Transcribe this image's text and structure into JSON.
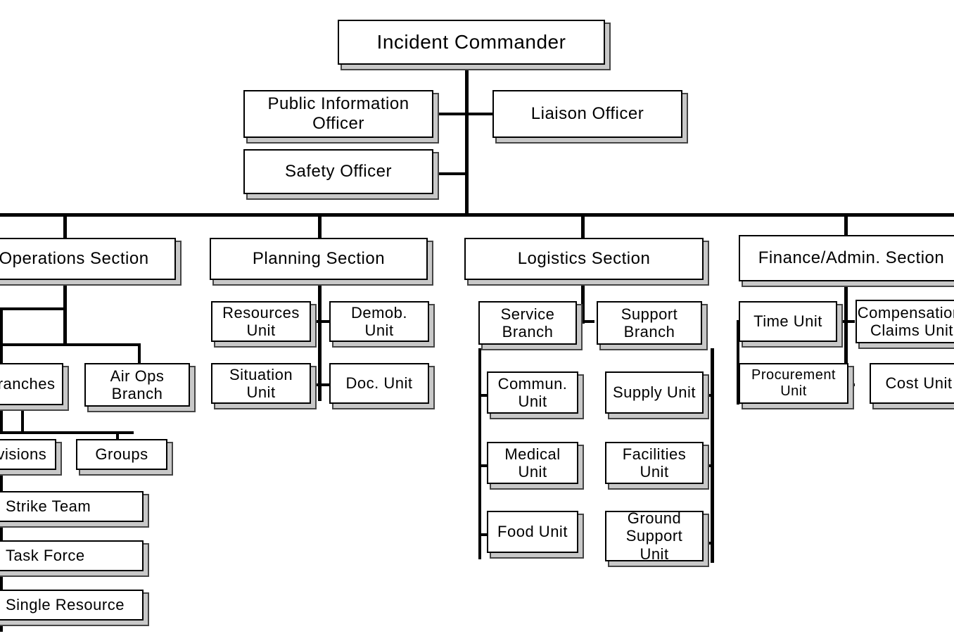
{
  "commander": "Incident Commander",
  "staff": {
    "pio": "Public Information Officer",
    "liaison": "Liaison Officer",
    "safety": "Safety Officer"
  },
  "sections": {
    "operations": {
      "title": "Operations Section",
      "branches_label": "Branches",
      "air_ops": "Air Ops Branch",
      "divisions": "Divisions",
      "groups": "Groups",
      "strike": "Strike Team",
      "task": "Task Force",
      "single": "Single Resource"
    },
    "planning": {
      "title": "Planning Section",
      "resources": "Resources Unit",
      "demob": "Demob. Unit",
      "situation": "Situation Unit",
      "doc": "Doc. Unit"
    },
    "logistics": {
      "title": "Logistics Section",
      "service": "Service Branch",
      "support": "Support Branch",
      "commun": "Commun. Unit",
      "medical": "Medical Unit",
      "food": "Food Unit",
      "supply": "Supply Unit",
      "facilities": "Facilities Unit",
      "ground": "Ground Support Unit"
    },
    "finance": {
      "title": "Finance/Admin. Section",
      "time": "Time Unit",
      "comp": "Compensation/ Claims Unit",
      "procurement": "Procurement Unit",
      "cost": "Cost Unit"
    }
  }
}
